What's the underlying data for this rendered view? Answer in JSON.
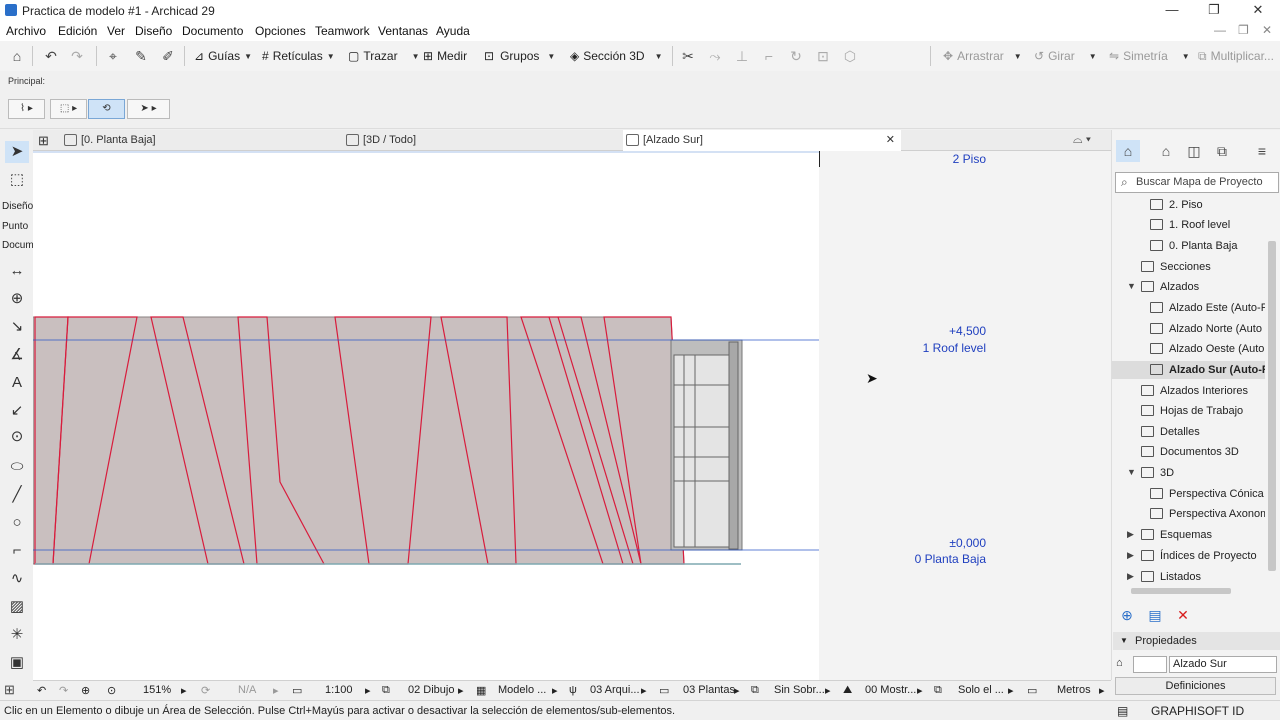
{
  "window": {
    "title": "Practica de modelo #1 - Archicad 29",
    "controls": [
      "minimize-icon",
      "restore-icon",
      "close-icon"
    ]
  },
  "menubar": {
    "items": [
      "Archivo",
      "Edición",
      "Ver",
      "Diseño",
      "Documento",
      "Opciones",
      "Teamwork",
      "Ventanas",
      "Ayuda"
    ]
  },
  "toolbar": {
    "guias": "Guías",
    "reticulas": "Retículas",
    "trazar": "Trazar",
    "medir": "Medir",
    "grupos": "Grupos",
    "seccion3d": "Sección 3D",
    "arrastrar": "Arrastrar",
    "girar": "Girar",
    "simetria": "Simetría",
    "multiplicar": "Multiplicar..."
  },
  "infobox": {
    "label": "Principal:"
  },
  "toolbox": {
    "groups": [
      "Diseño",
      "Punto",
      "Docum"
    ]
  },
  "tabs": [
    {
      "label": "[0. Planta Baja]"
    },
    {
      "label": "[3D / Todo]"
    },
    {
      "label": "[Alzado Sur]"
    }
  ],
  "canvas": {
    "levels": {
      "top": "2 Piso",
      "roof_value": "+4,500",
      "roof_label": "1 Roof level",
      "base_value": "±0,000",
      "base_label": "0 Planta Baja"
    },
    "colors": {
      "fill": "#c9bfbf",
      "stroke": "#d81c3c",
      "level_line": "#2b57c9"
    }
  },
  "navigator": {
    "search_placeholder": "Buscar Mapa de Proyecto",
    "tree": [
      {
        "label": "2. Piso"
      },
      {
        "label": "1. Roof level"
      },
      {
        "label": "0. Planta Baja"
      },
      {
        "label": "Secciones"
      },
      {
        "label": "Alzados"
      },
      {
        "label": "Alzado Este (Auto-R"
      },
      {
        "label": "Alzado Norte (Auto"
      },
      {
        "label": "Alzado Oeste (Auto"
      },
      {
        "label": "Alzado Sur (Auto-R"
      },
      {
        "label": "Alzados Interiores"
      },
      {
        "label": "Hojas de Trabajo"
      },
      {
        "label": "Detalles"
      },
      {
        "label": "Documentos 3D"
      },
      {
        "label": "3D"
      },
      {
        "label": "Perspectiva Cónica"
      },
      {
        "label": "Perspectiva Axonom"
      },
      {
        "label": "Esquemas"
      },
      {
        "label": "Índices de Proyecto"
      },
      {
        "label": "Listados"
      }
    ]
  },
  "properties": {
    "header": "Propiedades",
    "name_value": "Alzado Sur",
    "definiciones": "Definiciones"
  },
  "bottombar": {
    "zoom": "151%",
    "angle": "N/A",
    "scale": "1:100",
    "layer": "02 Dibujo",
    "model": "Modelo ...",
    "struct": "03 Arqui...",
    "plants": "03 Plantas",
    "override": "Sin Sobr...",
    "show": "00 Mostr...",
    "only": "Solo el ...",
    "units": "Metros"
  },
  "status": {
    "text": "Clic en un Elemento o dibuje un Área de Selección. Pulse Ctrl+Mayús para activar o desactivar la selección de elementos/sub-elementos.",
    "brand": "GRAPHISOFT ID"
  }
}
